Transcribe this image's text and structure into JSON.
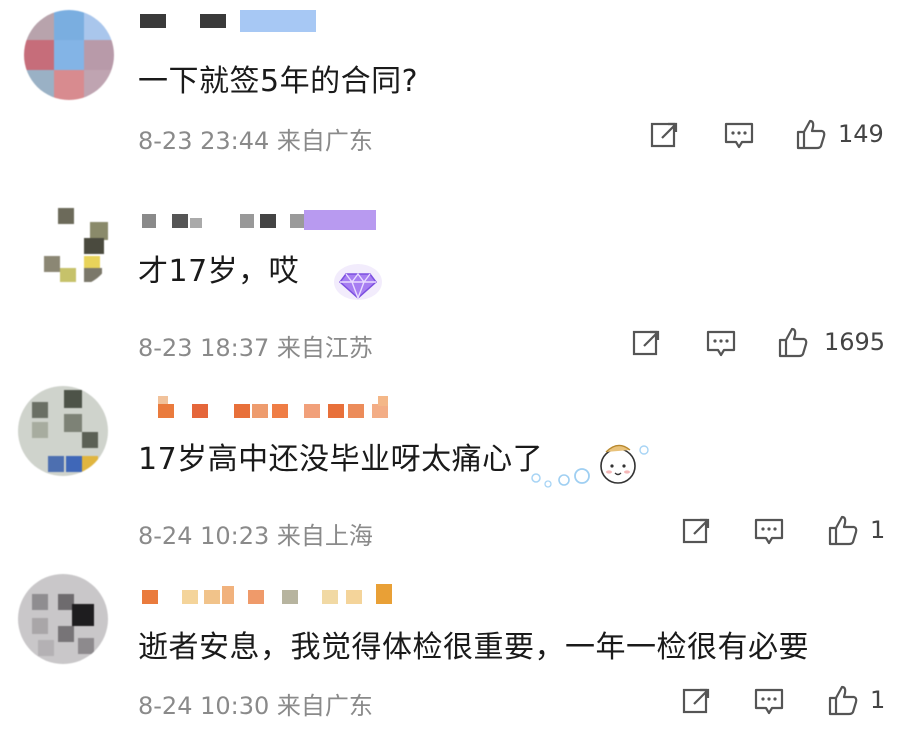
{
  "comments": [
    {
      "text": "一下就签5年的合同?",
      "date": "8-23 23:44",
      "location": "来自广东",
      "likes": "149",
      "actions": [
        "share-icon",
        "comment-icon",
        "like-icon"
      ]
    },
    {
      "text": "才17岁，哎",
      "date": "8-23 18:37",
      "location": "来自江苏",
      "likes": "1695",
      "actions": [
        "share-icon",
        "comment-icon",
        "like-icon"
      ]
    },
    {
      "text": "17岁高中还没毕业呀太痛心了",
      "date": "8-24 10:23",
      "location": "来自上海",
      "likes": "1",
      "actions": [
        "share-icon",
        "comment-icon",
        "like-icon"
      ]
    },
    {
      "text": "逝者安息，我觉得体检很重要，一年一检很有必要",
      "date": "8-24 10:30",
      "location": "来自广东",
      "likes": "1",
      "actions": [
        "share-icon",
        "comment-icon",
        "like-icon"
      ]
    }
  ],
  "colors": {
    "text": "#1a1a1a",
    "meta": "#8a8a8a",
    "icon": "#555555",
    "badge": "#9b6bf0"
  }
}
